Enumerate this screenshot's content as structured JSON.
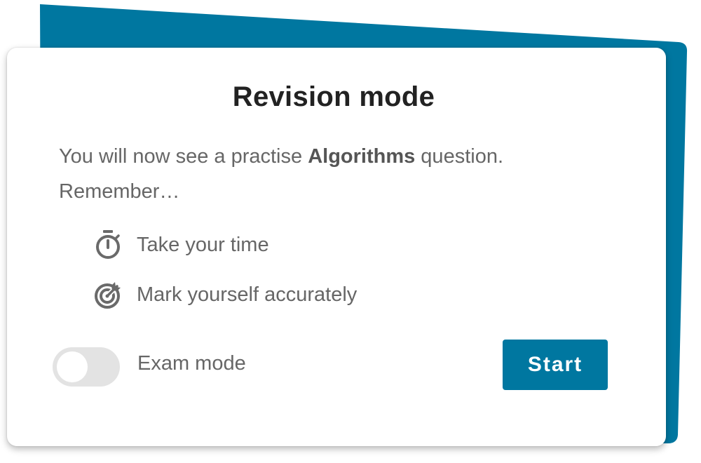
{
  "colors": {
    "accent": "#0077a0",
    "back_card": "#0077a0",
    "text_primary": "#222222",
    "text_secondary": "#666666",
    "toggle_track": "#e3e3e3"
  },
  "card": {
    "title": "Revision mode",
    "intro_before": "You will now see a practise ",
    "intro_subject": "Algorithms",
    "intro_after": " question.",
    "intro_line2": "Remember…"
  },
  "tips": [
    {
      "icon": "stopwatch-icon",
      "label": "Take your time"
    },
    {
      "icon": "target-icon",
      "label": "Mark yourself accurately"
    }
  ],
  "exam_mode": {
    "label": "Exam mode",
    "enabled": false
  },
  "start_button": {
    "label": "Start"
  }
}
